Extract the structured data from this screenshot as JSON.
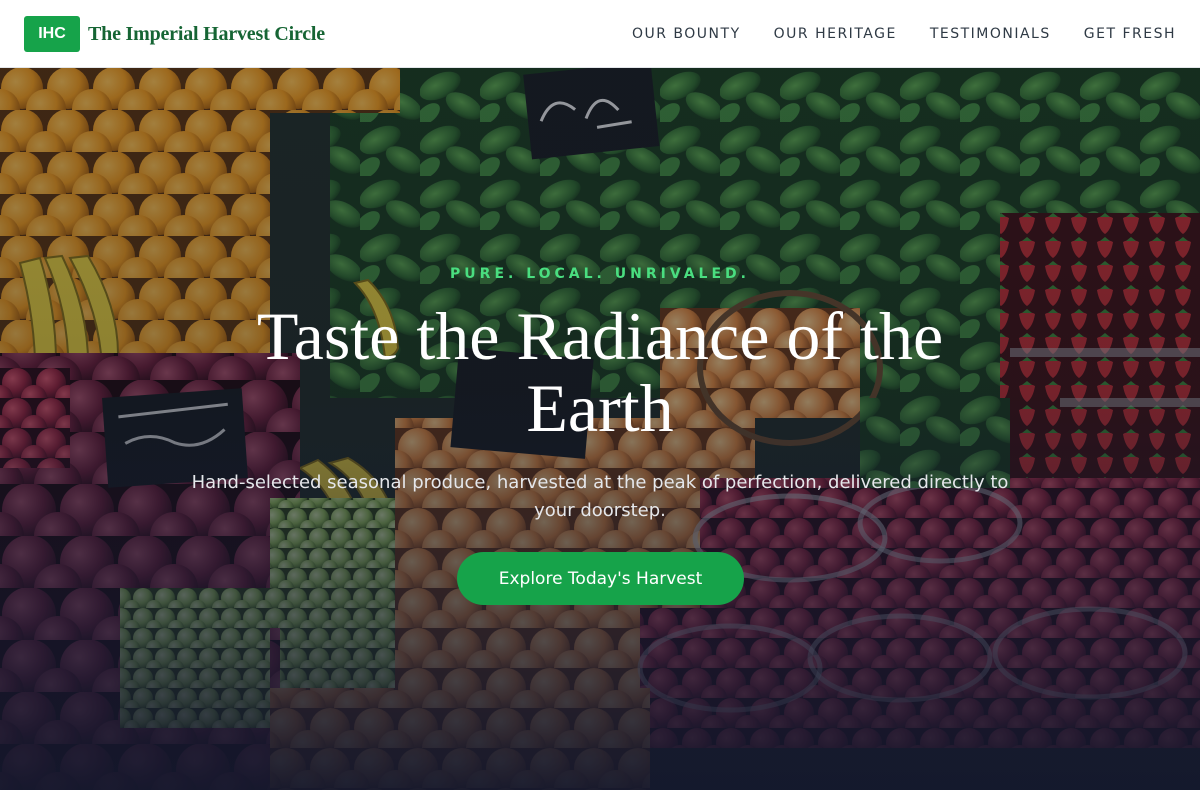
{
  "header": {
    "logo_text": "IHC",
    "brand_name": "The Imperial Harvest Circle",
    "nav": [
      {
        "label": "OUR BOUNTY"
      },
      {
        "label": "OUR HERITAGE"
      },
      {
        "label": "TESTIMONIALS"
      },
      {
        "label": "GET FRESH"
      }
    ]
  },
  "hero": {
    "image": "fresh-produce-market-photo",
    "eyebrow": "PURE. LOCAL. UNRIVALED.",
    "title": "Taste the Radiance of the Earth",
    "subtitle": "Hand-selected seasonal produce, harvested at the peak of perfection, delivered directly to your doorstep.",
    "cta_label": "Explore Today's Harvest"
  },
  "colors": {
    "brand_green": "#16a34a",
    "brand_dark_green": "#166534",
    "eyebrow_green": "#4ade80",
    "hero_overlay": "#141a30"
  }
}
